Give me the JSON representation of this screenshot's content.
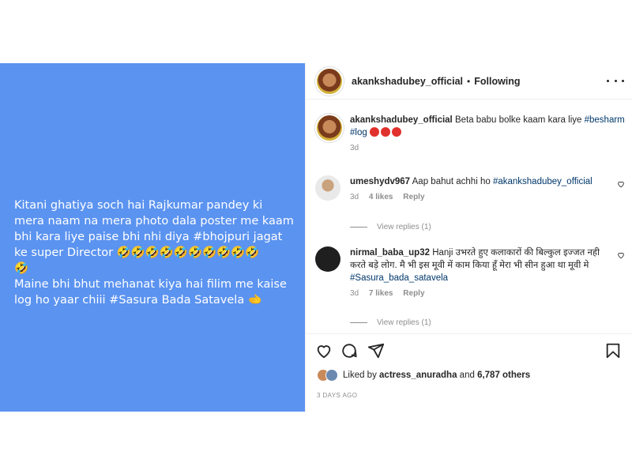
{
  "post": {
    "media_text": "Kitani ghatiya soch hai Rajkumar pandey ki mera naam na mera photo dala poster me kaam bhi kara liye paise bhi nhi diya #bhojpuri jagat ke super Director 🤣🤣🤣🤣🤣🤣🤣🤣🤣🤣\n🤣\nMaine bhi bhut mehanat kiya hai filim me kaise log ho yaar chiii #Sasura Bada Satavela 🫲"
  },
  "header": {
    "username": "akankshadubey_official",
    "separator": "•",
    "follow_status": "Following"
  },
  "caption": {
    "username": "akankshadubey_official",
    "text": "Beta babu bolke kaam kara liye ",
    "tag1": "#besharm",
    "tag2": "#log",
    "time": "3d"
  },
  "comments": [
    {
      "username": "umeshydv967",
      "text": "Aap bahut achhi ho ",
      "tag": "#akankshadubey_official",
      "time": "3d",
      "likes": "4 likes",
      "reply": "Reply",
      "view_replies": "View replies (1)"
    },
    {
      "username": "nirmal_baba_up32",
      "text": "Hanji उभरते हुए कलाकारों की बिल्कुल इज्जत नही करते बड़े लोग. मै भी इस मूवी में काम किया हूँ मेरा भी सीन हुआ था मूवी मे ",
      "tag": "#Sasura_bada_satavela",
      "time": "3d",
      "likes": "7 likes",
      "reply": "Reply",
      "view_replies": "View replies (1)"
    }
  ],
  "likes": {
    "prefix": "Liked by ",
    "user": "actress_anuradha",
    "middle": " and ",
    "count": "6,787 others"
  },
  "posted_ago": "3 DAYS AGO",
  "icons": [
    "heart-icon",
    "comment-icon",
    "share-icon",
    "bookmark-icon",
    "more-options-icon"
  ]
}
